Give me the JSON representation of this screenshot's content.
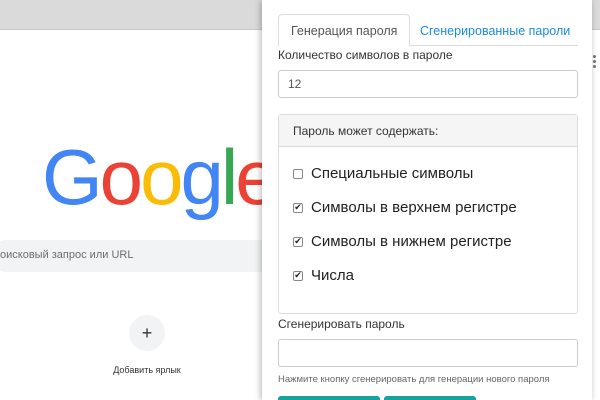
{
  "background": {
    "logo": {
      "letters": [
        {
          "char": "G",
          "color": "#4285F4"
        },
        {
          "char": "o",
          "color": "#EA4335"
        },
        {
          "char": "o",
          "color": "#FBBC05"
        },
        {
          "char": "g",
          "color": "#4285F4"
        },
        {
          "char": "l",
          "color": "#34A853"
        },
        {
          "char": "e",
          "color": "#EA4335"
        }
      ]
    },
    "search_placeholder": "оисковый запрос или URL",
    "add_shortcut_icon": "+",
    "add_shortcut_label": "Добавить ярлык"
  },
  "popup": {
    "tabs": [
      {
        "label": "Генерация пароля",
        "active": true
      },
      {
        "label": "Сгенерированные пароли",
        "active": false
      }
    ],
    "length_label": "Количество символов в пароле",
    "length_value": "12",
    "options_heading": "Пароль может содержать:",
    "options": [
      {
        "label": "Специальные символы",
        "checked": false
      },
      {
        "label": "Символы в верхнем регистре",
        "checked": true
      },
      {
        "label": "Символы в нижнем регистре",
        "checked": true
      },
      {
        "label": "Числа",
        "checked": true
      }
    ],
    "generated_label": "Сгенерировать пароль",
    "generated_value": "",
    "hint": "Нажмите кнопку сгенерировать для генерации нового пароля",
    "accent_color": "#17a2a0",
    "link_color": "#1a8ce0"
  }
}
